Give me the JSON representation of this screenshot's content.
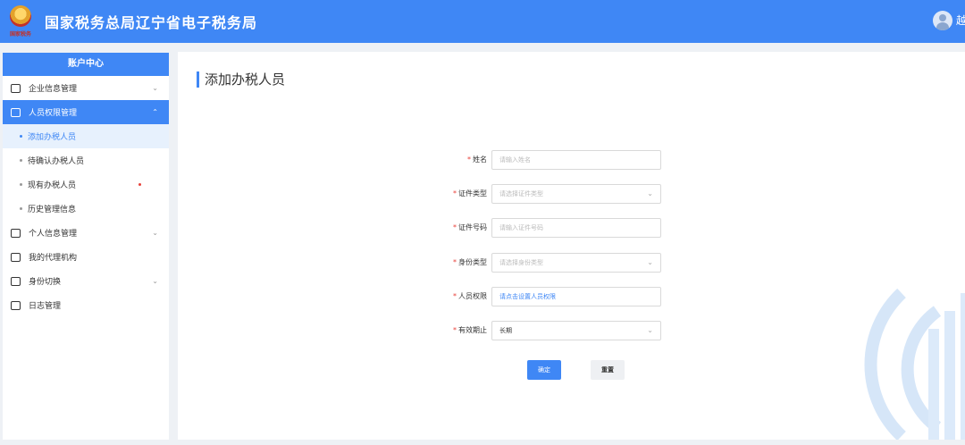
{
  "header": {
    "logo_text": "国家税务",
    "site_title": "国家税务总局辽宁省电子税务局",
    "user_name": "越"
  },
  "sidebar": {
    "title": "账户中心",
    "items": [
      {
        "label": "企业信息管理",
        "icon": "building-icon",
        "expanded": false
      },
      {
        "label": "人员权限管理",
        "icon": "user-lock-icon",
        "expanded": true,
        "active": true,
        "children": [
          {
            "label": "添加办税人员",
            "selected": true
          },
          {
            "label": "待确认办税人员"
          },
          {
            "label": "现有办税人员",
            "badge_dot": true
          },
          {
            "label": "历史管理信息"
          }
        ]
      },
      {
        "label": "个人信息管理",
        "icon": "id-card-icon",
        "expanded": false
      },
      {
        "label": "我的代理机构",
        "icon": "agency-icon"
      },
      {
        "label": "身份切换",
        "icon": "switch-icon",
        "expanded": false
      },
      {
        "label": "日志管理",
        "icon": "log-icon"
      }
    ]
  },
  "main": {
    "page_title": "添加办税人员",
    "form": {
      "name": {
        "label": "姓名",
        "placeholder": "请输入姓名"
      },
      "cert_type": {
        "label": "证件类型",
        "placeholder": "请选择证件类型"
      },
      "cert_no": {
        "label": "证件号码",
        "placeholder": "请输入证件号码"
      },
      "identity_type": {
        "label": "身份类型",
        "placeholder": "请选择身份类型"
      },
      "permission": {
        "label": "人员权限",
        "value": "请点击设置人员权限"
      },
      "valid_until": {
        "label": "有效期止",
        "value": "长期"
      }
    },
    "buttons": {
      "ok": "确定",
      "reset": "重置"
    }
  },
  "colors": {
    "brand": "#3f87f5",
    "required": "#e8413a"
  }
}
